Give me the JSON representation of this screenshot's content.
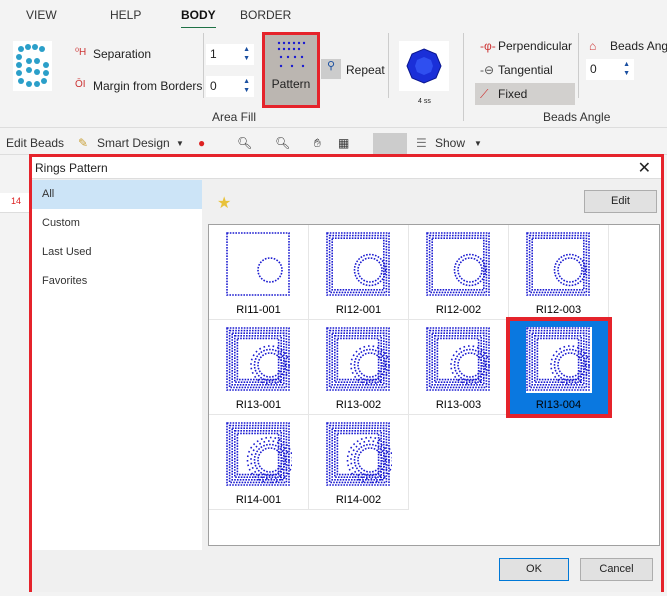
{
  "ribbon": {
    "tabs": [
      {
        "label": "VIEW"
      },
      {
        "label": "HELP"
      },
      {
        "label": "BODY",
        "active": true
      },
      {
        "label": "BORDER"
      }
    ],
    "separation_label": "Separation",
    "separation_value": "1",
    "margin_label": "Margin from Borders",
    "margin_value": "0",
    "pattern_label": "Pattern",
    "repeat_label": "Repeat",
    "bead_size": "4 ss",
    "area_fill_label": "Area Fill",
    "perpendicular_label": "Perpendicular",
    "tangential_label": "Tangential",
    "fixed_label": "Fixed",
    "beads_angle_label": "Beads Ang",
    "beads_angle_value": "0",
    "beads_angle_group": "Beads Angle"
  },
  "toolbar": {
    "edit_beads": "Edit Beads",
    "smart_design": "Smart Design",
    "show": "Show"
  },
  "background": {
    "ruler_number": "14"
  },
  "dialog": {
    "title": "Rings Pattern",
    "categories": [
      {
        "label": "All",
        "selected": true
      },
      {
        "label": "Custom"
      },
      {
        "label": "Last Used"
      },
      {
        "label": "Favorites"
      }
    ],
    "edit_label": "Edit",
    "patterns": [
      {
        "name": "RI11-001"
      },
      {
        "name": "RI12-001"
      },
      {
        "name": "RI12-002"
      },
      {
        "name": "RI12-003"
      },
      {
        "name": "RI13-001"
      },
      {
        "name": "RI13-002"
      },
      {
        "name": "RI13-003"
      },
      {
        "name": "RI13-004",
        "selected": true
      },
      {
        "name": "RI14-001"
      },
      {
        "name": "RI14-002"
      }
    ],
    "ok_label": "OK",
    "cancel_label": "Cancel"
  },
  "colors": {
    "accent": "#0a78e0",
    "highlight": "#e5232b",
    "bead": "#1a1ad0"
  }
}
